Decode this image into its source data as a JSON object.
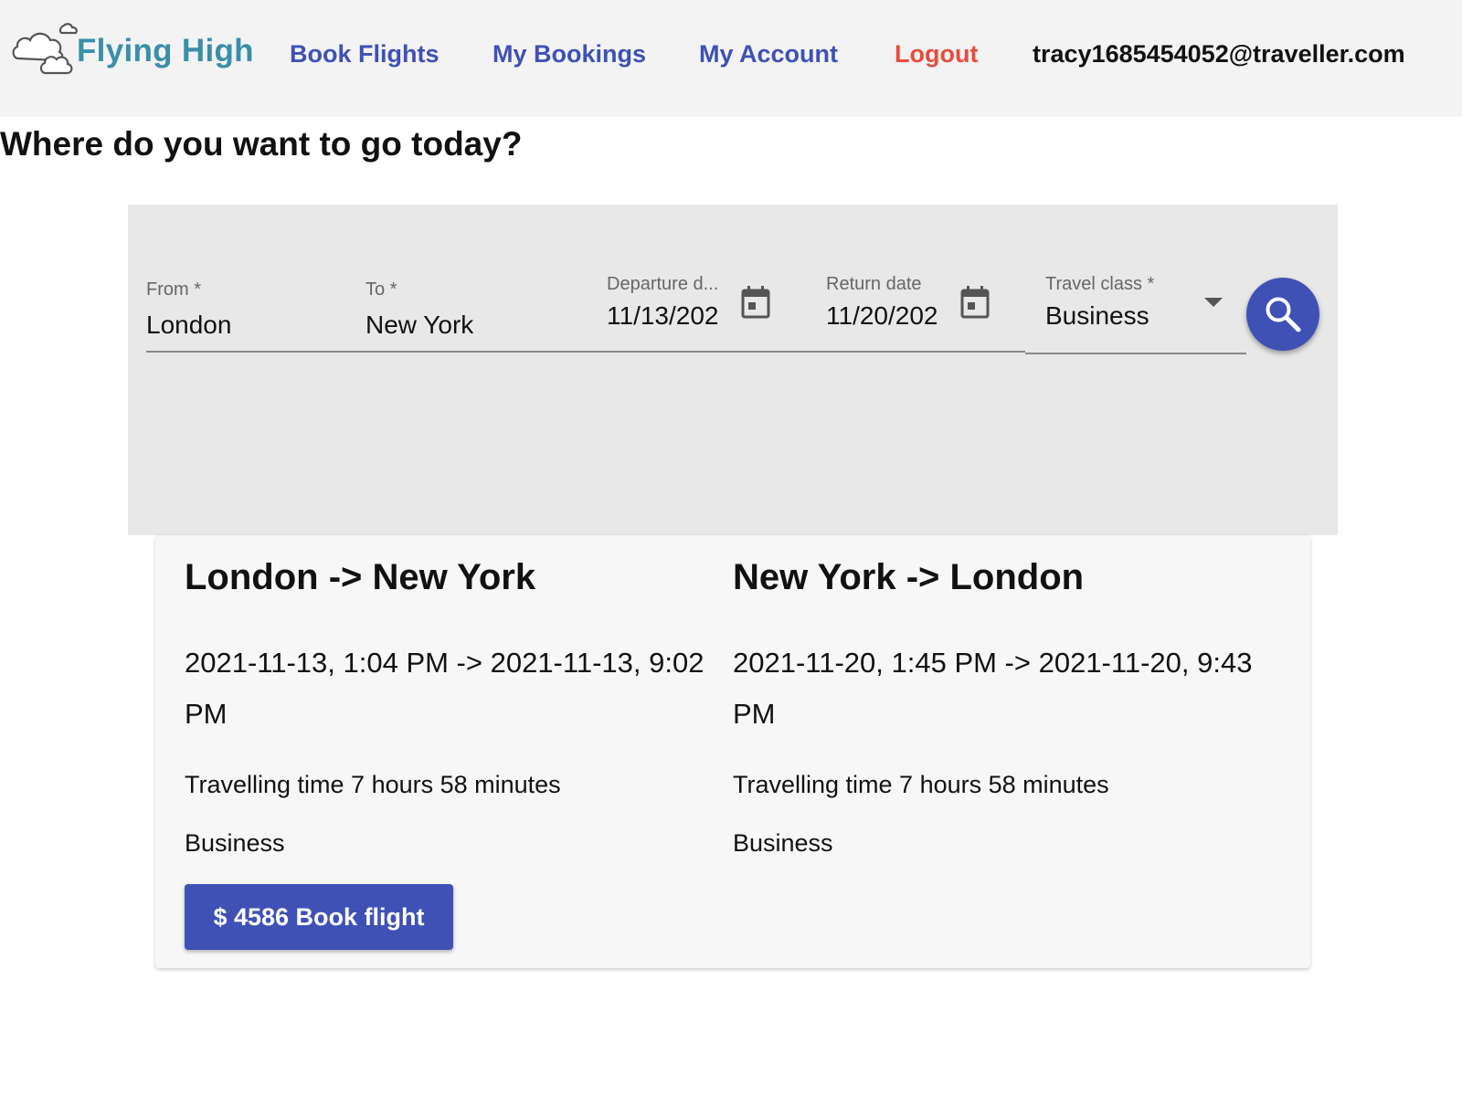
{
  "header": {
    "logo_text": "Flying High",
    "logo_icon": "cloud-icon",
    "nav": [
      {
        "label": "Book Flights"
      },
      {
        "label": "My Bookings"
      },
      {
        "label": "My Account"
      },
      {
        "label": "Logout"
      }
    ],
    "user_email": "tracy1685454052@traveller.com"
  },
  "page": {
    "title": "Where do you want to go today?"
  },
  "search": {
    "from": {
      "label": "From *",
      "value": "London"
    },
    "to": {
      "label": "To *",
      "value": "New York"
    },
    "departure": {
      "label": "Departure d...",
      "value": "11/13/202",
      "icon": "calendar-icon"
    },
    "return": {
      "label": "Return date",
      "value": "11/20/202",
      "icon": "calendar-icon"
    },
    "travel_class": {
      "label": "Travel class *",
      "value": "Business",
      "icon": "dropdown-arrow-icon"
    },
    "search_icon": "search-icon"
  },
  "result": {
    "outbound": {
      "title": "London -> New York",
      "times": "2021-11-13, 1:04 PM -> 2021-11-13, 9:02 PM",
      "duration": "Travelling time 7 hours 58 minutes",
      "class": "Business"
    },
    "inbound": {
      "title": "New York -> London",
      "times": "2021-11-20, 1:45 PM -> 2021-11-20, 9:43 PM",
      "duration": "Travelling time 7 hours 58 minutes",
      "class": "Business"
    },
    "book_button": "$ 4586 Book flight"
  },
  "colors": {
    "primary": "#3f51b5",
    "logout": "#e74c3c",
    "logo": "#3a8fa8",
    "header_bg": "#f3f3f3",
    "panel_bg": "#e8e8e8",
    "card_bg": "#f7f7f7"
  }
}
